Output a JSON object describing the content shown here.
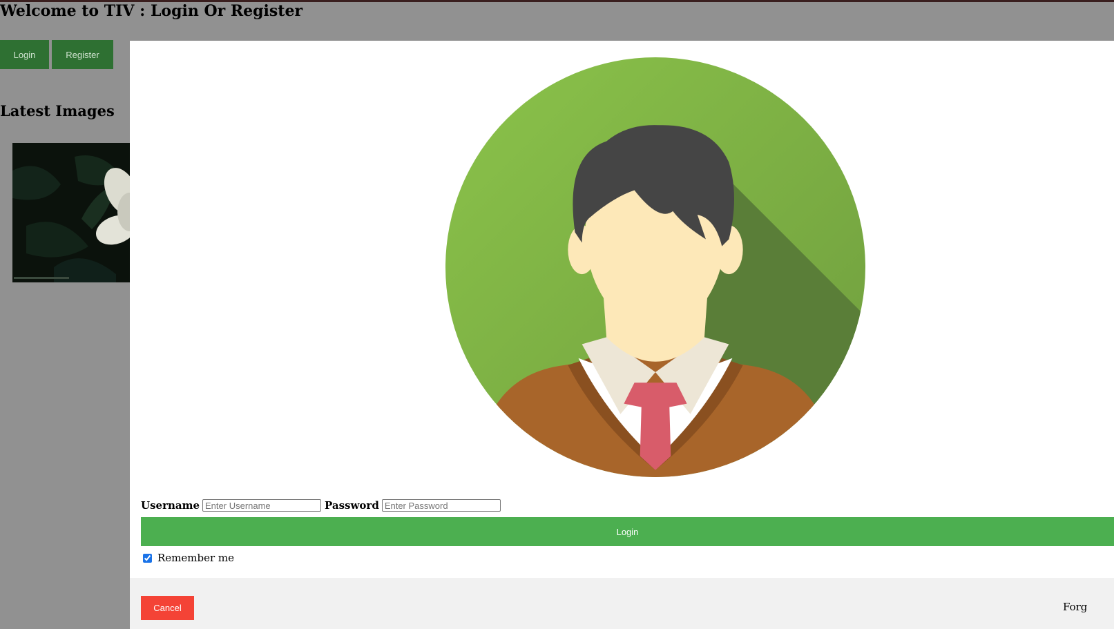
{
  "header": {
    "title": "Welcome to TIV : Login Or Register"
  },
  "nav": {
    "login_label": "Login",
    "register_label": "Register"
  },
  "gallery": {
    "title": "Latest Images"
  },
  "login_form": {
    "username_label": "Username",
    "username_placeholder": "Enter Username",
    "password_label": "Password",
    "password_placeholder": "Enter Password",
    "submit_label": "Login",
    "remember_label": "Remember me",
    "remember_checked": true,
    "cancel_label": "Cancel",
    "forgot_text": "Forg"
  },
  "colors": {
    "nav_button": "#2e7032",
    "submit_button": "#4caf50",
    "cancel_button": "#f44336",
    "overlay": "#919191",
    "avatar_circle": "#8bc34a"
  },
  "icons": {
    "avatar": "user-avatar-icon",
    "checkbox": "checkbox-checked-icon"
  }
}
